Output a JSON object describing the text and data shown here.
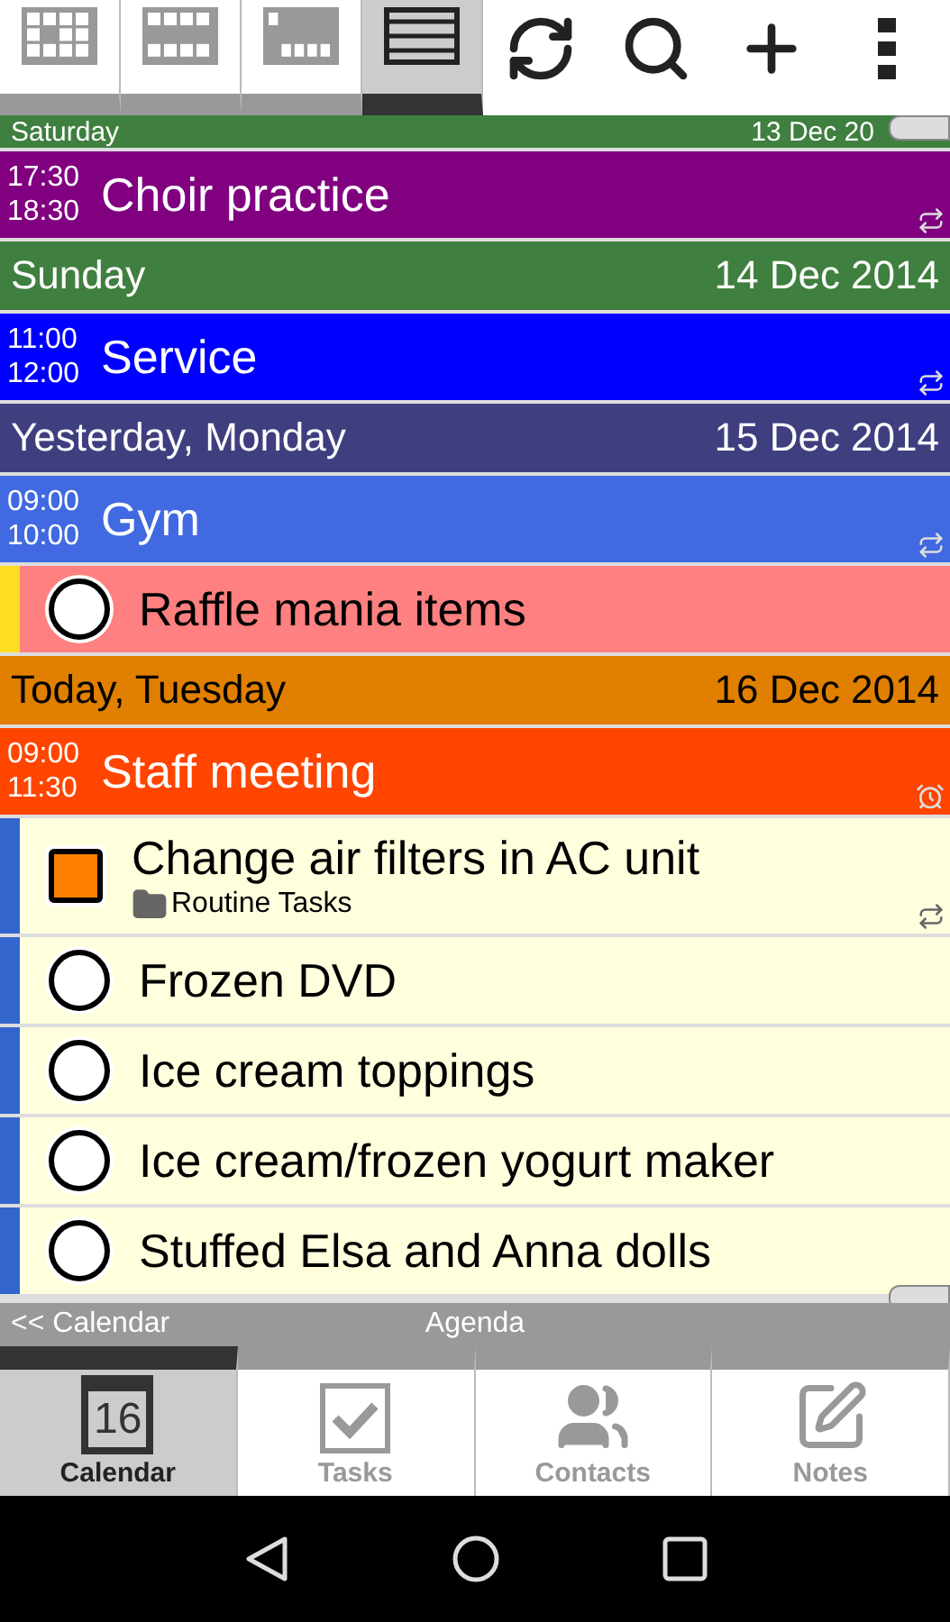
{
  "toolbar": {
    "view_tabs": [
      {
        "kind": "week",
        "selected": false
      },
      {
        "kind": "weeks",
        "selected": false
      },
      {
        "kind": "month",
        "selected": false
      },
      {
        "kind": "agenda",
        "selected": true
      }
    ],
    "actions": [
      {
        "kind": "sync"
      },
      {
        "kind": "search"
      },
      {
        "kind": "add"
      },
      {
        "kind": "more"
      }
    ]
  },
  "agenda": [
    {
      "kind": "day",
      "label": "Saturday",
      "date": "13 Dec 20",
      "color": "#3f7f3f",
      "today": false,
      "cut": true
    },
    {
      "kind": "event",
      "start": "17:30",
      "end": "18:30",
      "title": "Choir practice",
      "color": "#800080",
      "recurring": true,
      "alarm": false
    },
    {
      "kind": "day",
      "label": "Sunday",
      "date": "14 Dec 2014",
      "color": "#3f7f3f",
      "today": false,
      "cut": false
    },
    {
      "kind": "event",
      "start": "11:00",
      "end": "12:00",
      "title": "Service",
      "color": "#0000ff",
      "recurring": true,
      "alarm": false
    },
    {
      "kind": "day",
      "label": "Yesterday, Monday",
      "date": "15 Dec 2014",
      "color": "#3f3f7f",
      "today": false,
      "cut": false
    },
    {
      "kind": "event",
      "start": "09:00",
      "end": "10:00",
      "title": "Gym",
      "color": "#4169e1",
      "recurring": true,
      "alarm": false
    },
    {
      "kind": "task",
      "title": "Raffle mania items",
      "color": "#ffdd22",
      "overdue": true,
      "checked": false,
      "recurring": false
    },
    {
      "kind": "day",
      "label": "Today, Tuesday",
      "date": "16 Dec 2014",
      "color": "#e07f00",
      "today": true,
      "cut": false
    },
    {
      "kind": "event",
      "start": "09:00",
      "end": "11:30",
      "title": "Staff meeting",
      "color": "#ff4500",
      "recurring": false,
      "alarm": true
    },
    {
      "kind": "task",
      "title": "Change air filters in AC unit",
      "list": "Routine Tasks",
      "color": "#3366cc",
      "overdue": false,
      "checked": false,
      "recurring": true
    },
    {
      "kind": "task",
      "title": "Frozen DVD",
      "color": "#3366cc",
      "overdue": false,
      "checked": false,
      "recurring": false
    },
    {
      "kind": "task",
      "title": "Ice cream toppings",
      "color": "#3366cc",
      "overdue": false,
      "checked": false,
      "recurring": false
    },
    {
      "kind": "task",
      "title": "Ice cream/frozen yogurt maker",
      "color": "#3366cc",
      "overdue": false,
      "checked": false,
      "recurring": false
    },
    {
      "kind": "task",
      "title": "Stuffed Elsa and Anna dolls",
      "color": "#3366cc",
      "overdue": false,
      "checked": false,
      "recurring": false
    }
  ],
  "status_bar": {
    "back": "<< Calendar",
    "title": "Agenda"
  },
  "bottom_tabs": [
    {
      "kind": "calendar",
      "label": "Calendar",
      "icon_text": "16",
      "selected": true
    },
    {
      "kind": "tasks",
      "label": "Tasks",
      "selected": false
    },
    {
      "kind": "contacts",
      "label": "Contacts",
      "selected": false
    },
    {
      "kind": "notes",
      "label": "Notes",
      "selected": false
    }
  ]
}
